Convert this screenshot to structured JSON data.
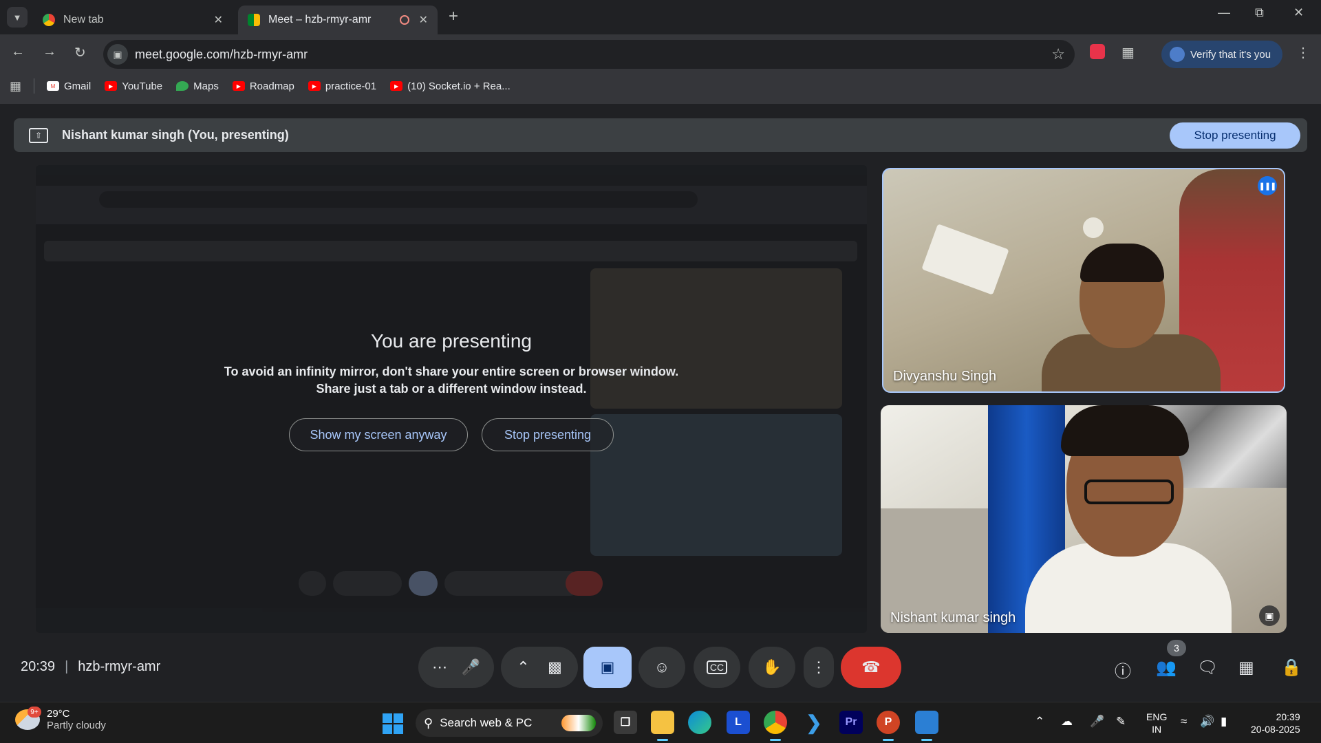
{
  "browser": {
    "tabs": [
      {
        "title": "New tab",
        "active": false
      },
      {
        "title": "Meet – hzb-rmyr-amr",
        "active": true
      }
    ],
    "url": "meet.google.com/hzb-rmyr-amr",
    "verify_label": "Verify that it's you",
    "bookmarks": [
      "Gmail",
      "YouTube",
      "Maps",
      "Roadmap",
      "practice-01",
      "(10) Socket.io + Rea..."
    ]
  },
  "meet": {
    "presenting_banner": "Nishant kumar singh (You, presenting)",
    "stop_presenting_label": "Stop presenting",
    "presenting_title": "You are presenting",
    "presenting_warning_line1": "To avoid an infinity mirror, don't share your entire screen or browser window.",
    "presenting_warning_line2": "Share just a tab or a different window instead.",
    "show_anyway_label": "Show my screen anyway",
    "stop_presenting_button": "Stop presenting",
    "participants": [
      {
        "name": "Divyanshu Singh",
        "speaking": true
      },
      {
        "name": "Nishant kumar singh",
        "speaking": false
      }
    ],
    "time": "20:39",
    "meeting_code": "hzb-rmyr-amr",
    "participant_count": "3",
    "accent_color": "#a8c7fa",
    "end_call_color": "#dc362e"
  },
  "taskbar": {
    "temperature": "29°C",
    "weather": "Partly cloudy",
    "weather_badge": "9+",
    "search_placeholder": "Search web & PC",
    "lang_line1": "ENG",
    "lang_line2": "IN",
    "clock_time": "20:39",
    "clock_date": "20-08-2025"
  }
}
